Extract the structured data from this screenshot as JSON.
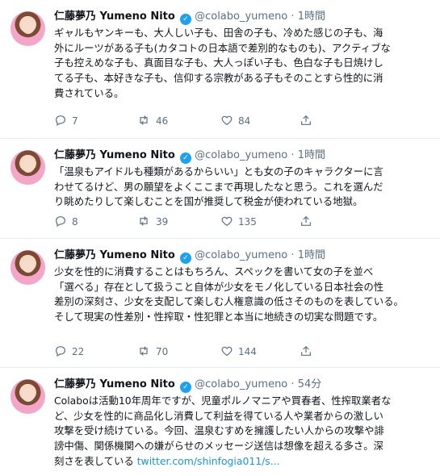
{
  "tweets": [
    {
      "name": "仁藤夢乃 Yumeno Nito",
      "handle": "@colabo_yumeno",
      "dot": "·",
      "time": "1時間",
      "lines": [
        "ギャルもヤンキーも、大人しい子も、田舎の子も、冷めた感じの子も、海",
        "外にルーツがある子も(カタコトの日本語で差別的なものも)、アクティブな",
        "子も控えめな子も、真面目な子も、大人っぽい子も、色白な子も日焼けし",
        "てる子も、本好きな子も、信仰する宗教がある子もそのことすら性的に消",
        "費されている。"
      ],
      "reply": "7",
      "retweet": "46",
      "like": "84"
    },
    {
      "name": "仁藤夢乃 Yumeno Nito",
      "handle": "@colabo_yumeno",
      "dot": "·",
      "time": "1時間",
      "lines": [
        "「温泉もアイドルも種類があるからいい」とも女の子のキャラクターに言",
        "わせてるけど、男の願望をよくここまで再現したなと思う。これを選んだ",
        "り眺めたりして楽しむことを国が推奨して税金が使われている地獄。"
      ],
      "reply": "8",
      "retweet": "39",
      "like": "135"
    },
    {
      "name": "仁藤夢乃 Yumeno Nito",
      "handle": "@colabo_yumeno",
      "dot": "·",
      "time": "1時間",
      "lines": [
        "少女を性的に消費することはもちろん、スペックを書いて女の子を並べ",
        "「選べる」存在として扱うこと自体が少女をモノ化している日本社会の性",
        "差別の深刻さ、少女を支配して楽しむ人権意識の低さそのものを表している。",
        "そして現実の性差別・性搾取・性犯罪と本当に地続きの切実な問題です。"
      ],
      "reply": "22",
      "retweet": "70",
      "like": "144"
    },
    {
      "name": "仁藤夢乃 Yumeno Nito",
      "handle": "@colabo_yumeno",
      "dot": "·",
      "time": "54分",
      "lines": [
        "Colaboは活動10年周年ですが、児童ポルノマニアや買春者、性搾取業者な",
        "ど、少女を性的に商品化し消費して利益を得ている人や業者からの激しい",
        "攻撃を受け続けている。今回、温泉むすめを擁護したい人からの攻撃や誹",
        "謗中傷、関係機関への嫌がらせのメッセージ送信は想像を超える多さ。深"
      ],
      "last_text": "刻さを表している ",
      "link": "twitter.com/shinfogia011/s...",
      "reply": "",
      "retweet": "",
      "like": ""
    }
  ]
}
